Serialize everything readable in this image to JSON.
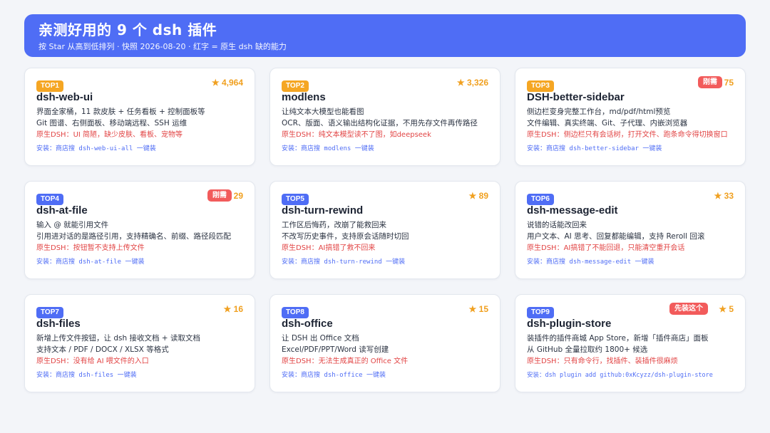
{
  "header": {
    "title": "亲测好用的 9 个 dsh 插件",
    "subtitle": "按 Star 从高到低排列 · 快照 2026-08-20 · 红字 = 原生 dsh 缺的能力"
  },
  "cards": [
    {
      "rank": "TOP1",
      "stars": "★ 4,964",
      "name": "dsh-web-ui",
      "desc1": "界面全家桶，11 款皮肤 + 任务看板 + 控制面板等",
      "desc2": "Git 图谱、右侧面板、移动端远程、SSH 运维",
      "native": "原生DSH：UI 简陋，缺少皮肤、看板、宠物等",
      "install": "安装：商店搜 dsh-web-ui-all 一键装"
    },
    {
      "rank": "TOP2",
      "stars": "★ 3,326",
      "name": "modlens",
      "desc1": "让纯文本大模型也能看图",
      "desc2": "OCR、版面、语义输出结构化证据，不用先存文件再传路径",
      "native": "原生DSH：纯文本模型读不了图，如deepseek",
      "install": "安装：商店搜 modlens 一键装"
    },
    {
      "rank": "TOP3",
      "stars": "75",
      "tag": "刚需",
      "name": "DSH-better-sidebar",
      "desc1": "侧边栏变身完整工作台，md/pdf/html预览",
      "desc2": "文件编辑、真实终端、Git、子代理、内嵌浏览器",
      "native": "原生DSH：侧边栏只有会话树，打开文件、跑条命令得切换窗口",
      "install": "安装：商店搜 dsh-better-sidebar 一键装"
    },
    {
      "rank": "TOP4",
      "stars": "29",
      "tag": "刚需",
      "name": "dsh-at-file",
      "desc1": "输入 @ 就能引用文件",
      "desc2": "引用进对话的是路径引用，支持精确名、前缀、路径段匹配",
      "native": "原生DSH：按钮暂不支持上传文件",
      "install": "安装：商店搜 dsh-at-file 一键装"
    },
    {
      "rank": "TOP5",
      "stars": "★ 89",
      "name": "dsh-turn-rewind",
      "desc1": "工作区后悔药，改崩了能救回来",
      "desc2": "不改写历史事件，支持原会话随时切回",
      "native": "原生DSH：AI搞错了救不回来",
      "install": "安装：商店搜 dsh-turn-rewind 一键装"
    },
    {
      "rank": "TOP6",
      "stars": "★ 33",
      "name": "dsh-message-edit",
      "desc1": "说错的话能改回来",
      "desc2": "用户文本、AI 思考、回复都能编辑，支持 Reroll 回滚",
      "native": "原生DSH：AI搞错了不能回退，只能清空重开会话",
      "install": "安装：商店搜 dsh-message-edit 一键装"
    },
    {
      "rank": "TOP7",
      "stars": "★ 16",
      "name": "dsh-files",
      "desc1": "新增上传文件按钮，让 dsh 接收文档 + 读取文档",
      "desc2": "支持文本 / PDF / DOCX / XLSX 等格式",
      "native": "原生DSH：没有给 AI 喂文件的入口",
      "install": "安装：商店搜 dsh-files 一键装"
    },
    {
      "rank": "TOP8",
      "stars": "★ 15",
      "name": "dsh-office",
      "desc1": "让 DSH 出 Office 文档",
      "desc2": "Excel/PDF/PPT/Word 读写创建",
      "native": "原生DSH：无法生成真正的 Office 文件",
      "install": "安装：商店搜 dsh-office 一键装"
    },
    {
      "rank": "TOP9",
      "stars": "★ 5",
      "tag": "先装这个",
      "name": "dsh-plugin-store",
      "desc1": "装插件的插件商城 App Store，新增「插件商店」面板",
      "desc2": "从 GitHub 全量拉取约 1800+ 候选",
      "native": "原生DSH：只有命令行，找插件、装插件很麻烦",
      "install": "安装：dsh plugin add github:0xKcyzz/dsh-plugin-store"
    }
  ]
}
